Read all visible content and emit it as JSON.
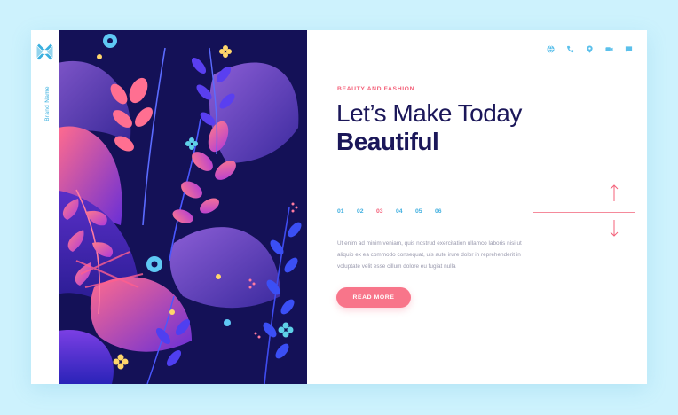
{
  "brand": {
    "name": "Brand Name"
  },
  "hero": {
    "eyebrow": "BEAUTY AND FASHION",
    "title_line1": "Let’s Make Today",
    "title_line2": "Beautiful",
    "body": "Ut enim ad minim veniam, quis nostrud exercitation ullamco laboris nisi ut aliquip ex ea commodo consequat, uis aute irure dolor in reprehenderit in voluptate velit esse cillum dolore eu fugiat nulla",
    "cta_label": "READ MORE"
  },
  "pagination": {
    "pages": [
      "01",
      "02",
      "03",
      "04",
      "05",
      "06"
    ],
    "active": "03"
  },
  "top_icons": [
    "globe-icon",
    "phone-icon",
    "location-pin-icon",
    "video-icon",
    "chat-icon"
  ],
  "colors": {
    "background": "#cdf2fd",
    "accent_pink": "#f4617a",
    "accent_blue": "#42b0e0",
    "navy": "#1b1759",
    "art_background": "#141157"
  }
}
